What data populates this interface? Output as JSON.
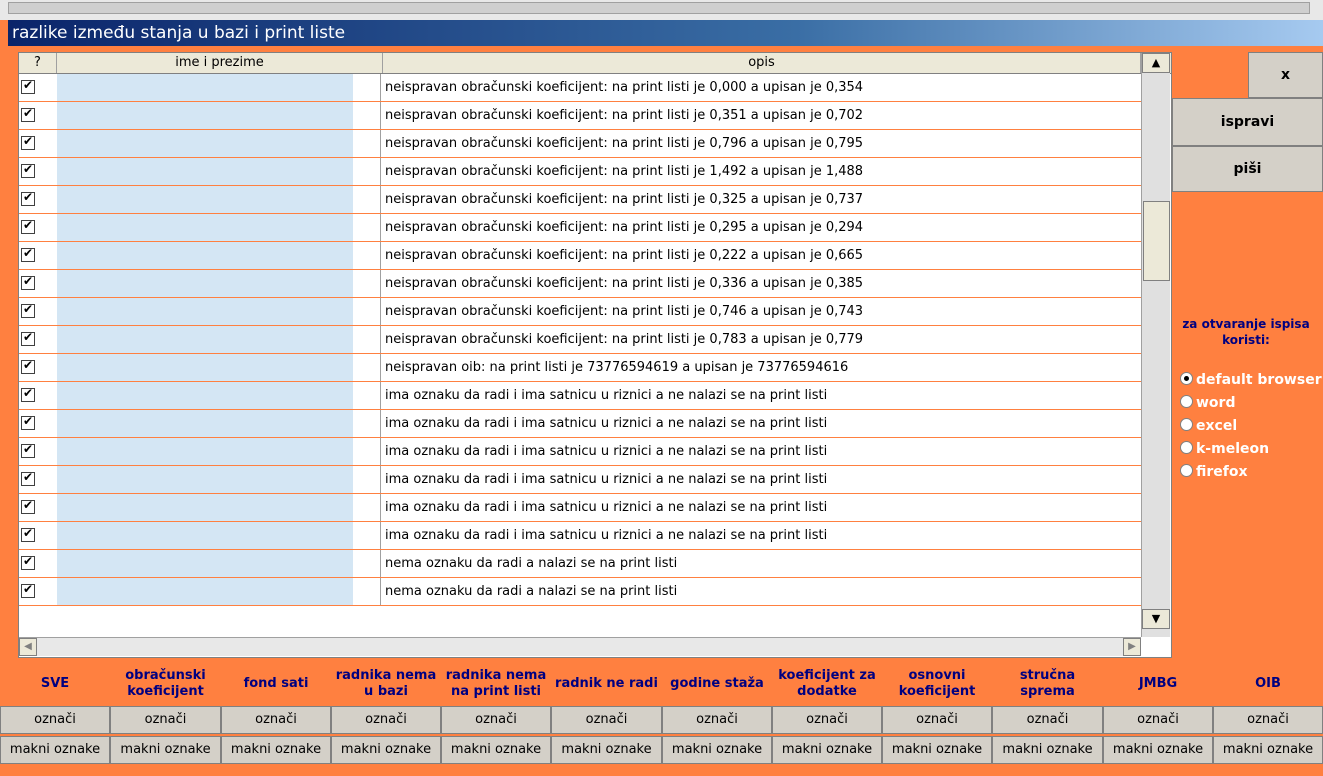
{
  "window": {
    "title": "razlike između stanja u bazi i print liste"
  },
  "grid": {
    "headers": {
      "check": "?",
      "name": "ime i prezime",
      "opis": "opis"
    },
    "rows": [
      {
        "opis": "neispravan obračunski koeficijent: na print listi je 0,000 a upisan je 0,354"
      },
      {
        "opis": "neispravan obračunski koeficijent: na print listi je 0,351 a upisan je 0,702"
      },
      {
        "opis": "neispravan obračunski koeficijent: na print listi je 0,796 a upisan je 0,795"
      },
      {
        "opis": "neispravan obračunski koeficijent: na print listi je 1,492 a upisan je 1,488"
      },
      {
        "opis": "neispravan obračunski koeficijent: na print listi je 0,325 a upisan je 0,737"
      },
      {
        "opis": "neispravan obračunski koeficijent: na print listi je 0,295 a upisan je 0,294"
      },
      {
        "opis": "neispravan obračunski koeficijent: na print listi je 0,222 a upisan je 0,665"
      },
      {
        "opis": "neispravan obračunski koeficijent: na print listi je 0,336 a upisan je 0,385"
      },
      {
        "opis": "neispravan obračunski koeficijent: na print listi je 0,746 a upisan je 0,743"
      },
      {
        "opis": "neispravan obračunski koeficijent: na print listi je 0,783 a upisan je 0,779"
      },
      {
        "opis": "neispravan oib: na print listi je 73776594619 a upisan je 73776594616"
      },
      {
        "opis": "ima oznaku da radi i ima satnicu u riznici a ne nalazi se na print listi"
      },
      {
        "opis": "ima oznaku da radi i ima satnicu u riznici a ne nalazi se na print listi"
      },
      {
        "opis": "ima oznaku da radi i ima satnicu u riznici a ne nalazi se na print listi"
      },
      {
        "opis": "ima oznaku da radi i ima satnicu u riznici a ne nalazi se na print listi"
      },
      {
        "opis": "ima oznaku da radi i ima satnicu u riznici a ne nalazi se na print listi"
      },
      {
        "opis": "ima oznaku da radi i ima satnicu u riznici a ne nalazi se na print listi"
      },
      {
        "opis": "nema oznaku da radi a nalazi se na print listi"
      },
      {
        "opis": "nema oznaku da radi a nalazi se na print listi"
      }
    ]
  },
  "side": {
    "close_label": "x",
    "ispravi_label": "ispravi",
    "pisi_label": "piši",
    "open_with_label": "za otvaranje ispisa koristi:",
    "options": [
      "default browser",
      "word",
      "excel",
      "k-meleon",
      "firefox"
    ],
    "selected": "default browser"
  },
  "filters": {
    "columns": [
      "SVE",
      "obračunski koeficijent",
      "fond sati",
      "radnika nema u bazi",
      "radnika nema na print listi",
      "radnik ne radi",
      "godine staža",
      "koeficijent za dodatke",
      "osnovni koeficijent",
      "stručna sprema",
      "JMBG",
      "OIB"
    ],
    "mark_label": "označi",
    "unmark_label": "makni oznake"
  },
  "colors": {
    "background": "#ff8040",
    "name_cell": "#d4e6f4",
    "header_text": "#000080"
  }
}
